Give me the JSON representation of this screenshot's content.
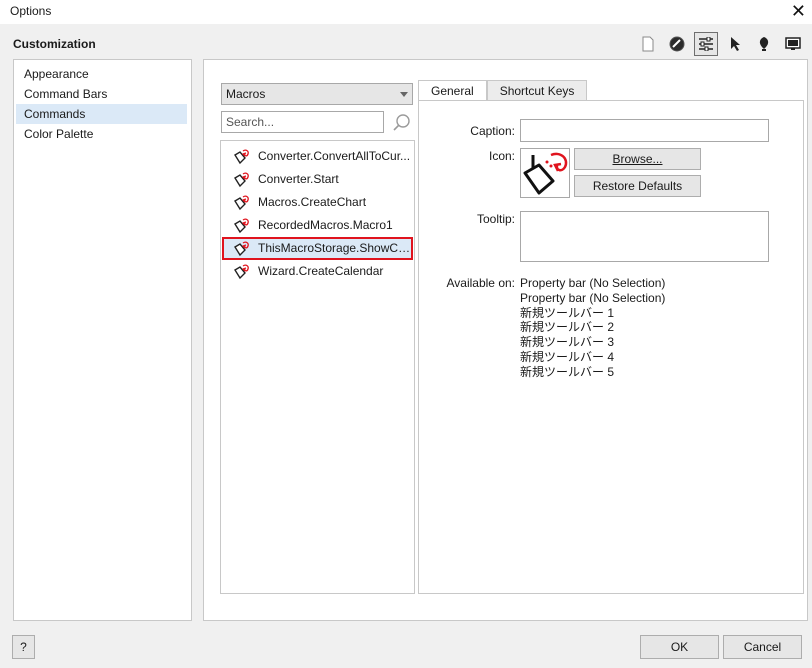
{
  "window": {
    "title": "Options",
    "close_glyph": "✕"
  },
  "section_title": "Customization",
  "toolbar_icons": [
    {
      "name": "page-icon"
    },
    {
      "name": "color-disc-icon"
    },
    {
      "name": "customize-sliders-icon",
      "active": true
    },
    {
      "name": "pointer-icon"
    },
    {
      "name": "pen-nib-icon"
    },
    {
      "name": "monitor-icon"
    }
  ],
  "sidebar": {
    "items": [
      {
        "label": "Appearance"
      },
      {
        "label": "Command Bars"
      },
      {
        "label": "Commands",
        "selected": true
      },
      {
        "label": "Color Palette"
      }
    ]
  },
  "commands": {
    "category": "Macros",
    "search_placeholder": "Search...",
    "items": [
      {
        "label": "Converter.ConvertAllToCur..."
      },
      {
        "label": "Converter.Start"
      },
      {
        "label": "Macros.CreateChart"
      },
      {
        "label": "RecordedMacros.Macro1"
      },
      {
        "label": "ThisMacroStorage.ShowCu...",
        "selected": true
      },
      {
        "label": "Wizard.CreateCalendar"
      }
    ]
  },
  "tabs": [
    {
      "label": "General",
      "active": true
    },
    {
      "label": "Shortcut Keys"
    }
  ],
  "general": {
    "caption_label": "Caption:",
    "caption_value": "",
    "icon_label": "Icon:",
    "browse_label": "Browse...",
    "restore_label": "Restore Defaults",
    "tooltip_label": "Tooltip:",
    "tooltip_value": "",
    "available_label": "Available on:",
    "available_items": [
      "Property bar (No Selection)",
      "Property bar (No Selection)",
      "新規ツールバー 1",
      "新規ツールバー 2",
      "新規ツールバー 3",
      "新規ツールバー 4",
      "新規ツールバー 5"
    ]
  },
  "footer": {
    "help_label": "?",
    "ok_label": "OK",
    "cancel_label": "Cancel"
  },
  "colors": {
    "selection_bg": "#dbe9f7",
    "highlight_outline": "#e0141e",
    "macro_arrow": "#e0141e"
  }
}
